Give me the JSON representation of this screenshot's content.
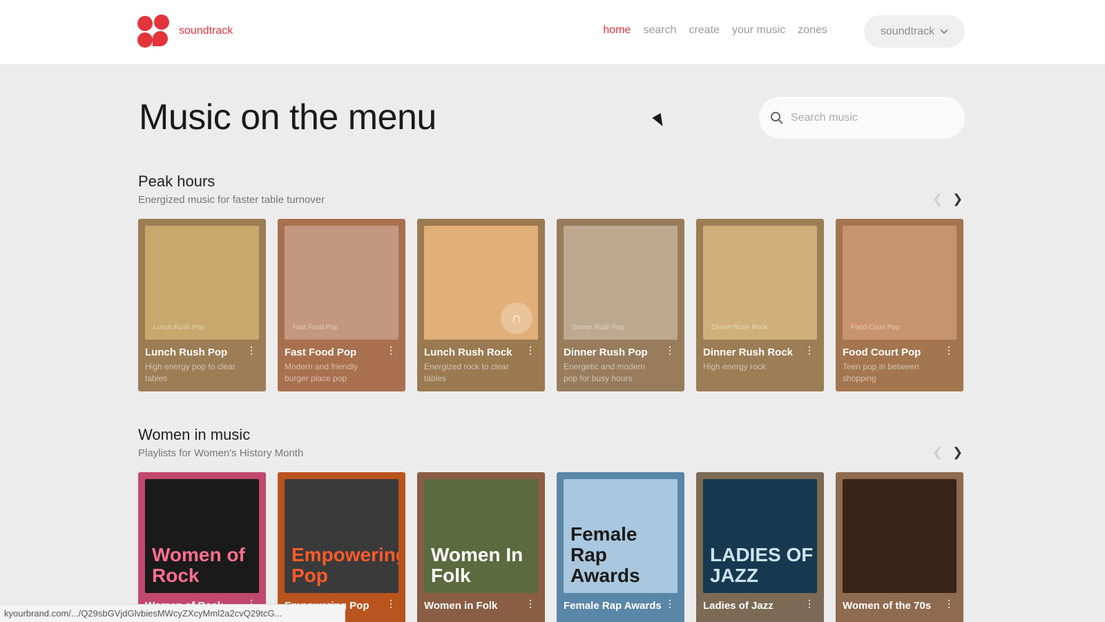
{
  "brand": {
    "name": "soundtrack",
    "logo": "clover-logo",
    "color": "#e3333b"
  },
  "nav": {
    "items": [
      {
        "label": "home",
        "active": true
      },
      {
        "label": "search",
        "active": false
      },
      {
        "label": "create",
        "active": false
      },
      {
        "label": "your music",
        "active": false
      },
      {
        "label": "zones",
        "active": false
      }
    ],
    "account_label": "soundtrack"
  },
  "page": {
    "title": "Music on the menu"
  },
  "search": {
    "placeholder": "Search music"
  },
  "sections": [
    {
      "title": "Peak hours",
      "subtitle": "Energized music for faster table turnover",
      "cards": [
        {
          "title": "Lunch Rush Pop",
          "description": "High energy pop to clear tables",
          "bg": "#9c7d55",
          "art": "#c9a86e",
          "caption": "Lunch Rush Pop"
        },
        {
          "title": "Fast Food Pop",
          "description": "Modern and friendly burger place pop",
          "bg": "#a8704e",
          "art": "#c39880",
          "caption": "Fast Food Pop"
        },
        {
          "title": "Lunch Rush Rock",
          "description": "Energized rock to clear tables",
          "bg": "#9b7a52",
          "art": "#e2af79",
          "caption": "",
          "badge": "headphones-icon"
        },
        {
          "title": "Dinner Rush Pop",
          "description": "Energetic and modern pop for busy hours",
          "bg": "#987c5c",
          "art": "#bea990",
          "caption": "Dinner Rush Pop"
        },
        {
          "title": "Dinner Rush Rock",
          "description": "High energy rock",
          "bg": "#9c7d55",
          "art": "#cfb07a",
          "caption": "Dinner Rush Rock"
        },
        {
          "title": "Food Court Pop",
          "description": "Teen pop in between shopping",
          "bg": "#a37650",
          "art": "#c8946e",
          "caption": "Food Court Pop"
        }
      ]
    },
    {
      "title": "Women in music",
      "subtitle": "Playlists for Women's History Month",
      "cards": [
        {
          "title": "Women of Rock",
          "description": "",
          "bg": "#c0486e",
          "art": "#1a1a1a",
          "label": "Women of Rock",
          "label_color": "#ff6f8f"
        },
        {
          "title": "Empowering Pop",
          "description": "",
          "bg": "#b9541f",
          "art": "#3a3a3a",
          "label": "Empowering Pop",
          "label_color": "#ff5b2a"
        },
        {
          "title": "Women in Folk",
          "description": "",
          "bg": "#8a5e45",
          "art": "#5b6a3f",
          "label": "Women In Folk",
          "label_color": "#ffffff"
        },
        {
          "title": "Female Rap Awards",
          "description": "",
          "bg": "#5a86a8",
          "art": "#a9c7de",
          "label": "Female Rap Awards",
          "label_color": "#1a1a1a"
        },
        {
          "title": "Ladies of Jazz",
          "description": "",
          "bg": "#7c6a55",
          "art": "#16394f",
          "label": "LADIES OF JAZZ",
          "label_color": "#cfe3f2"
        },
        {
          "title": "Women of the 70s",
          "description": "",
          "bg": "#8e6a50",
          "art": "#3a2417",
          "label": "",
          "label_color": "#ff2a2a"
        }
      ]
    }
  ],
  "statusbar": {
    "text": "kyourbrand.com/.../Q29sbGVjdGlvbiesMWcyZXcyMml2a2cvQ29tcG..."
  }
}
